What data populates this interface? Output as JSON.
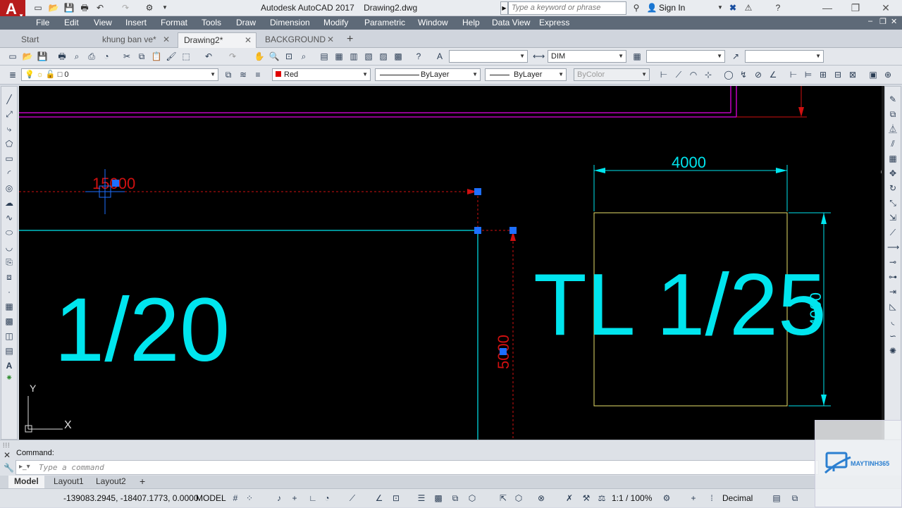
{
  "titlebar": {
    "title": "Autodesk AutoCAD 2017    Drawing2.dwg",
    "search_placeholder": "Type a keyword or phrase",
    "sign_in": "Sign In"
  },
  "menu": [
    "File",
    "Edit",
    "View",
    "Insert",
    "Format",
    "Tools",
    "Draw",
    "Dimension",
    "Modify",
    "Parametric",
    "Window",
    "Help",
    "Data View",
    "Express"
  ],
  "file_tabs": [
    {
      "label": "Start",
      "active": false
    },
    {
      "label": "khung ban ve*",
      "active": false
    },
    {
      "label": "Drawing2*",
      "active": true
    },
    {
      "label": "BACKGROUND",
      "active": false
    }
  ],
  "toolbar1": {
    "dim_style": "DIM"
  },
  "toolbar2": {
    "layer": "0",
    "color": "Red",
    "color_hex": "#e00000",
    "linetype": "ByLayer",
    "lineweight": "ByLayer",
    "plotstyle": "ByColor"
  },
  "drawing": {
    "dim_horizontal_red": "15000",
    "dim_vertical_red": "5000",
    "dim_top_cyan": "4000",
    "dim_side_cyan": "4000",
    "text_left": "1/20",
    "text_right": "TL 1/25",
    "ucs_x": "X",
    "ucs_y": "Y",
    "colors": {
      "cyan": "#00e5ee",
      "red": "#d01010",
      "magenta": "#c000c0",
      "yellow": "#e8e06a",
      "grip": "#1e6fff"
    }
  },
  "command": {
    "history": "Command:",
    "placeholder": "Type a command"
  },
  "layout_tabs": [
    {
      "label": "Model",
      "active": true
    },
    {
      "label": "Layout1",
      "active": false
    },
    {
      "label": "Layout2",
      "active": false
    }
  ],
  "status": {
    "coords": "-139083.2945, -18407.1773, 0.0000",
    "space": "MODEL",
    "scale": "1:1 / 100%",
    "units": "Decimal"
  },
  "watermark": {
    "brand": "MAYTINH365"
  }
}
